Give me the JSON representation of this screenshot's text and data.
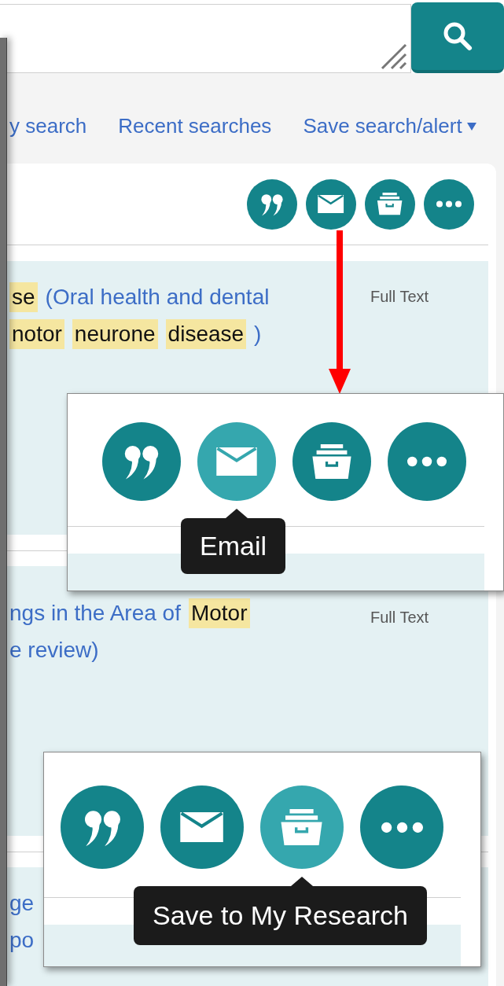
{
  "links": [
    {
      "label": "y search",
      "dropdown": false
    },
    {
      "label": "Recent searches",
      "dropdown": false
    },
    {
      "label": "Save search/alert",
      "dropdown": true
    }
  ],
  "toolbar": [
    {
      "kind": "cite"
    },
    {
      "kind": "email"
    },
    {
      "kind": "save"
    },
    {
      "kind": "more"
    }
  ],
  "results": [
    {
      "lines": [
        [
          {
            "text": "se",
            "highlight": true
          },
          {
            "text": "(Oral health and dental",
            "highlight": false
          }
        ],
        [
          {
            "text": "notor",
            "highlight": true
          },
          {
            "text": "neurone",
            "highlight": true
          },
          {
            "text": "disease",
            "highlight": true
          },
          {
            "text": ")",
            "highlight": false
          }
        ]
      ],
      "full_text": "Full Text"
    },
    {
      "lines": [
        [
          {
            "text": "ngs in the Area of",
            "highlight": false
          },
          {
            "text": "Motor",
            "highlight": true
          }
        ],
        [
          {
            "text": "e review)",
            "highlight": false
          }
        ]
      ],
      "full_text": "Full Text"
    },
    {
      "lines": [
        [
          {
            "text": "ge",
            "highlight": false
          }
        ],
        [
          {
            "text": "po",
            "highlight": false
          }
        ]
      ]
    }
  ],
  "callouts": [
    {
      "buttons": [
        {
          "kind": "cite",
          "hovered": false
        },
        {
          "kind": "email",
          "hovered": true
        },
        {
          "kind": "save",
          "hovered": false
        },
        {
          "kind": "more",
          "hovered": false
        }
      ],
      "tooltip": "Email"
    },
    {
      "buttons": [
        {
          "kind": "cite",
          "hovered": false
        },
        {
          "kind": "email",
          "hovered": false
        },
        {
          "kind": "save",
          "hovered": true
        },
        {
          "kind": "more",
          "hovered": false
        }
      ],
      "tooltip": "Save to My Research"
    }
  ]
}
